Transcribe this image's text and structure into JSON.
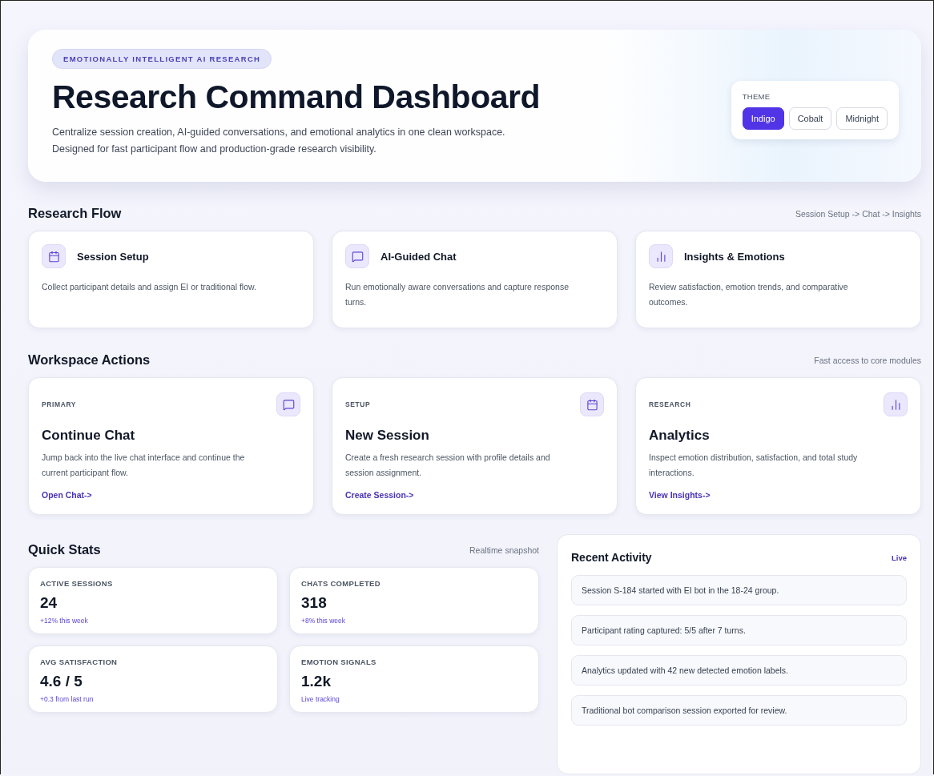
{
  "hero": {
    "eyebrow": "EMOTIONALLY INTELLIGENT AI RESEARCH",
    "title": "Research Command Dashboard",
    "description": [
      "Centralize session creation, AI-guided conversations, and emotional analytics in one clean workspace.",
      "Designed for fast participant flow and production-grade research visibility."
    ],
    "theme": {
      "label": "THEME",
      "options": [
        {
          "label": "Indigo",
          "selected": true
        },
        {
          "label": "Cobalt",
          "selected": false
        },
        {
          "label": "Midnight",
          "selected": false
        }
      ]
    }
  },
  "research_flow": {
    "title": "Research Flow",
    "hint": "Session Setup -> Chat -> Insights",
    "steps": [
      {
        "title": "Session Setup",
        "text": "Collect participant details and assign EI or traditional flow."
      },
      {
        "title": "AI-Guided Chat",
        "text": "Run emotionally aware conversations and capture response turns."
      },
      {
        "title": "Insights & Emotions",
        "text": "Review satisfaction, emotion trends, and comparative outcomes."
      }
    ]
  },
  "workspace_actions": {
    "title": "Workspace Actions",
    "hint": "Fast access to core modules",
    "cards": [
      {
        "tag": "PRIMARY",
        "title": "Continue Chat",
        "text": "Jump back into the live chat interface and continue the current participant flow.",
        "link": "Open Chat->"
      },
      {
        "tag": "SETUP",
        "title": "New Session",
        "text": "Create a fresh research session with profile details and session assignment.",
        "link": "Create Session->"
      },
      {
        "tag": "RESEARCH",
        "title": "Analytics",
        "text": "Inspect emotion distribution, satisfaction, and total study interactions.",
        "link": "View Insights->"
      }
    ]
  },
  "quick_stats": {
    "title": "Quick Stats",
    "hint": "Realtime snapshot",
    "stats": [
      {
        "label": "ACTIVE SESSIONS",
        "value": "24",
        "note": "+12% this week"
      },
      {
        "label": "CHATS COMPLETED",
        "value": "318",
        "note": "+8% this week"
      },
      {
        "label": "AVG SATISFACTION",
        "value": "4.6 / 5",
        "note": "+0.3 from last run"
      },
      {
        "label": "EMOTION SIGNALS",
        "value": "1.2k",
        "note": "Live tracking"
      }
    ]
  },
  "recent_activity": {
    "title": "Recent Activity",
    "badge": "Live",
    "items": [
      "Session S-184 started with EI bot in the 18-24 group.",
      "Participant rating captured: 5/5 after 7 turns.",
      "Analytics updated with 42 new detected emotion labels.",
      "Traditional bot comparison session exported for review."
    ]
  }
}
